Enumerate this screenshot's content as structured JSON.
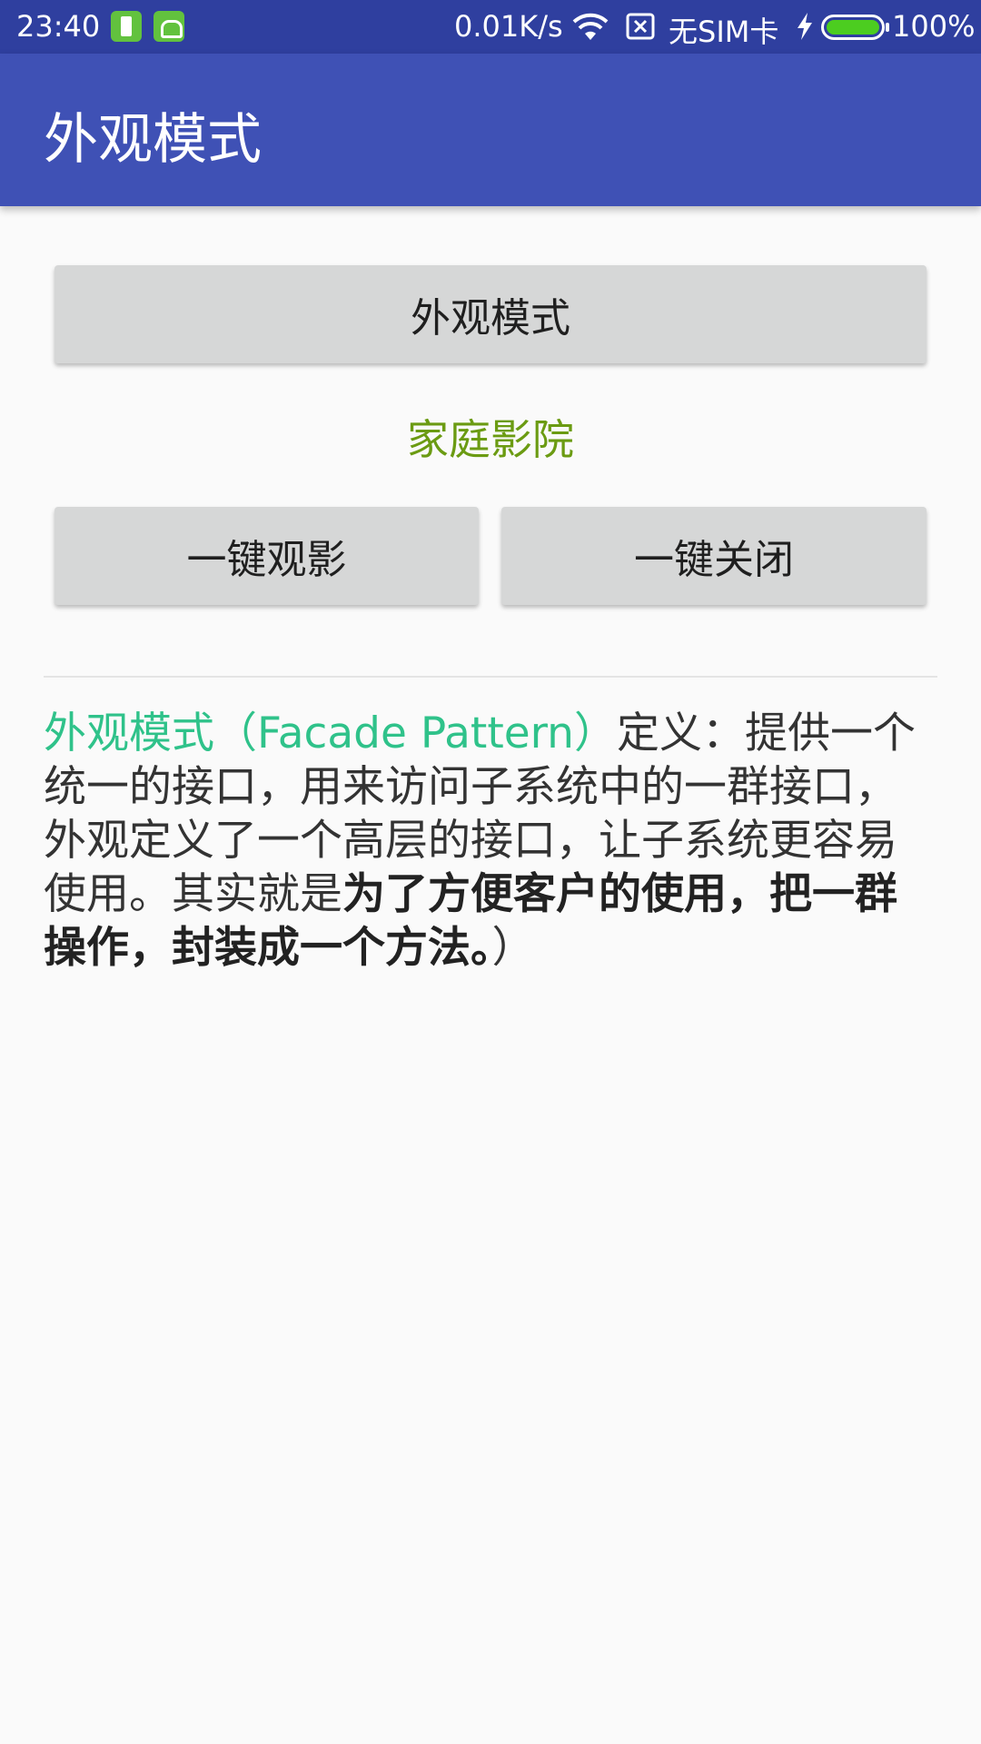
{
  "status_bar": {
    "time": "23:40",
    "network_speed": "0.01K/s",
    "sim_status": "无SIM卡",
    "battery_percent": "100%",
    "battery_level": 1.0,
    "icons": [
      "battery-app-icon",
      "android-app-icon",
      "wifi-icon",
      "no-sim-icon",
      "charging-bolt-icon",
      "battery-icon"
    ]
  },
  "app_bar": {
    "title": "外观模式"
  },
  "main": {
    "facade_button_label": "外观模式",
    "home_theater_label": "家庭影院",
    "one_click_watch_label": "一键观影",
    "one_click_close_label": "一键关闭",
    "definition": {
      "term": "外观模式（Facade Pattern）",
      "text": "定义：提供一个统一的接口，用来访问子系统中的一群接口，外观定义了一个高层的接口，让子系统更容易使用。其实就是",
      "bold_text": "为了方便客户的使用，把一群操作，封装成一个方法。",
      "closing": "）"
    }
  },
  "colors": {
    "status_bar": "#2f3f9f",
    "app_bar": "#3f51b5",
    "button": "#d6d7d7",
    "home_theater_text": "#6b9b12",
    "term_text": "#2fc28a"
  }
}
